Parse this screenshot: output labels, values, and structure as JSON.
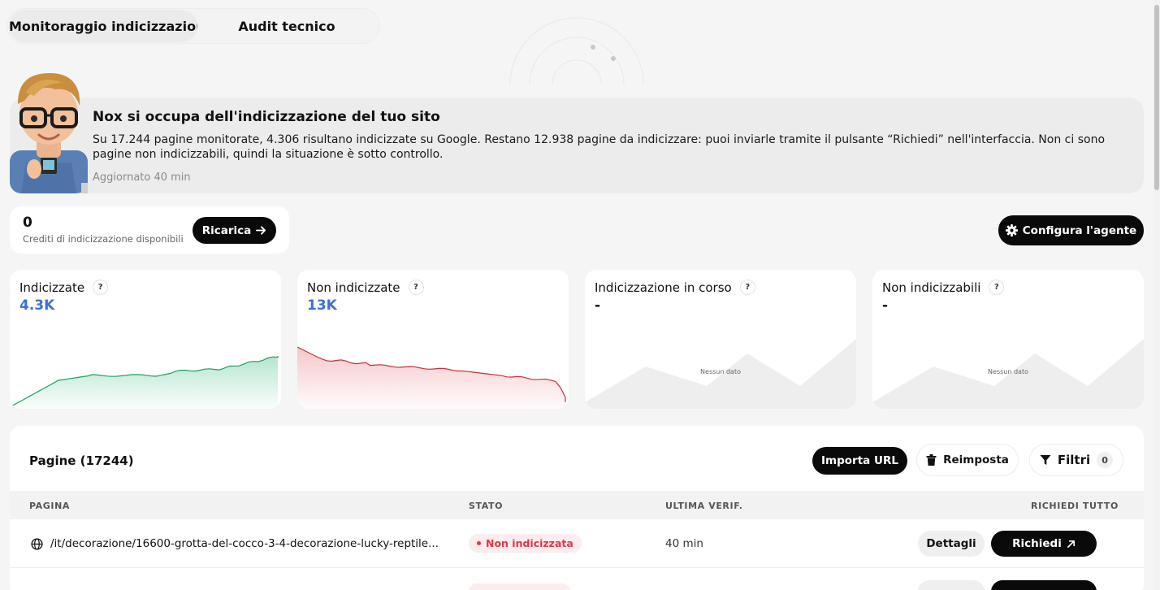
{
  "tabs": {
    "monitoring": "Monitoraggio indicizzazione",
    "audit": "Audit tecnico"
  },
  "banner": {
    "title": "Nox si occupa dell'indicizzazione del tuo sito",
    "text": "Su 17.244 pagine monitorate, 4.306 risultano indicizzate su Google. Restano 12.938 pagine da indicizzare: puoi inviarle tramite il pulsante “Richiedi” nell'interfaccia. Non ci sono pagine non indicizzabili, quindi la situazione è sotto controllo.",
    "updated": "Aggiornato 40 min"
  },
  "credits": {
    "value": "0",
    "label": "Crediti di indicizzazione disponibili",
    "reload_label": "Ricarica"
  },
  "config_label": "Configura l'agente",
  "cards": [
    {
      "title": "Indicizzate",
      "help": "?",
      "value": "4.3K",
      "color": "#2bb673",
      "fill": "#d8f3e6"
    },
    {
      "title": "Non indicizzate",
      "help": "?",
      "value": "13K",
      "color": "#d9363e",
      "fill": "#fbdadd"
    },
    {
      "title": "Indicizzazione in corso",
      "help": "?",
      "value": "-",
      "empty": "Nessun dato"
    },
    {
      "title": "Non indicizzabili",
      "help": "?",
      "value": "-",
      "empty": "Nessun dato"
    }
  ],
  "pages": {
    "title": "Pagine (17244)",
    "import_label": "Importa URL",
    "reset_label": "Reimposta",
    "filter_label": "Filtri",
    "filter_count": "0",
    "columns": {
      "page": "PAGINA",
      "status": "STATO",
      "last_check": "ULTIMA VERIF.",
      "request_all": "RICHIEDI TUTTO"
    },
    "rows": [
      {
        "url": "/it/decorazione/16600-grotta-del-cocco-3-4-decorazione-lucky-reptile...",
        "status": "Non indicizzata",
        "last_check": "40 min",
        "details_label": "Dettagli",
        "request_label": "Richiedi"
      }
    ]
  },
  "icons": {
    "reload": "arrow-right-icon",
    "config": "gear-icon",
    "import": "none",
    "reset": "trash-icon",
    "filter": "funnel-icon",
    "url": "globe-icon",
    "request": "arrow-up-right-icon"
  }
}
